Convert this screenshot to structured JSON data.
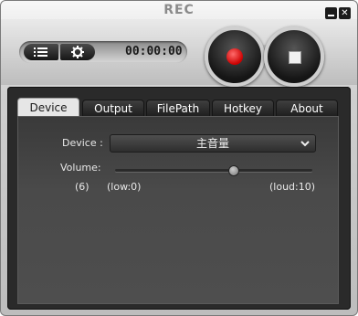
{
  "window": {
    "title": "REC",
    "minimize_label": "",
    "close_label": "✕"
  },
  "controls": {
    "timer": "00:00:00",
    "list_icon": "list-icon",
    "gear_icon": "gear-icon",
    "record_icon": "record-icon",
    "stop_icon": "stop-icon"
  },
  "tabs": [
    {
      "label": "Device",
      "active": true
    },
    {
      "label": "Output",
      "active": false
    },
    {
      "label": "FilePath",
      "active": false
    },
    {
      "label": "Hotkey",
      "active": false
    },
    {
      "label": "About",
      "active": false
    }
  ],
  "device": {
    "device_label": "Device :",
    "device_value": "主音量",
    "volume_label": "Volume:",
    "volume_value_text": "(6)",
    "volume_min_text": "(low:0)",
    "volume_max_text": "(loud:10)",
    "volume_level": 6,
    "volume_min": 0,
    "volume_max": 10
  },
  "colors": {
    "record_accent": "#cc0000",
    "panel_bg": "#2a2a2a"
  }
}
